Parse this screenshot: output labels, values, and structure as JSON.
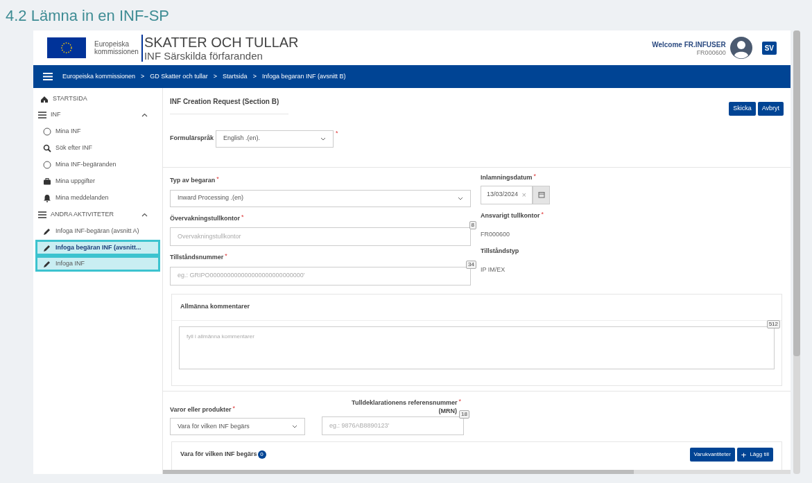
{
  "page_title": "4.2 Lämna in en INF-SP",
  "header": {
    "logo_line1": "Europeiska",
    "logo_line2": "kommissionen",
    "title": "SKATTER OCH TULLAR",
    "subtitle": "INF Särskilda förfaranden",
    "welcome": "Welcome FR.INFUSER",
    "user_id": "FR000600",
    "language": "SV"
  },
  "breadcrumbs": [
    "Europeiska kommissionen",
    "GD Skatter och tullar",
    "Startsida",
    "Infoga begaran INF (avsnitt B)"
  ],
  "breadcrumb_separator": ">",
  "sidebar": {
    "items": [
      {
        "kind": "link",
        "label": "STARTSIDA",
        "selected": false,
        "highlighted": false
      },
      {
        "kind": "group",
        "label": "INF",
        "expanded": true,
        "children": [
          {
            "kind": "circle",
            "label": "Mina INF",
            "selected": false,
            "highlighted": false
          },
          {
            "kind": "search",
            "label": "Sök efter INF",
            "selected": false,
            "highlighted": false
          },
          {
            "kind": "circle",
            "label": "Mina INF-begäranden",
            "selected": false,
            "highlighted": false
          },
          {
            "kind": "briefcase",
            "label": "Mina uppgifter",
            "selected": false,
            "highlighted": false
          },
          {
            "kind": "bell",
            "label": "Mina meddelanden",
            "selected": false,
            "highlighted": false
          }
        ]
      },
      {
        "kind": "group",
        "label": "ANDRA AKTIVITETER",
        "expanded": true,
        "children": [
          {
            "kind": "pencil",
            "label": "Infoga INF-begäran (avsnitt A)",
            "selected": false,
            "highlighted": false
          },
          {
            "kind": "pencil",
            "label": "Infoga begäran INF (avsnitt...",
            "selected": true,
            "highlighted": true
          },
          {
            "kind": "pencil",
            "label": "Infoga INF",
            "selected": false,
            "highlighted": true
          }
        ]
      }
    ]
  },
  "required_mark": "*",
  "main": {
    "heading": "INF Creation Request (Section B)",
    "buttons": [
      "Skicka",
      "Avbryt"
    ],
    "form_language": {
      "label": "Formulärspråk",
      "value": "English .(en).",
      "required": true
    },
    "left_fields": [
      {
        "kind": "select",
        "label": "Typ av begaran",
        "required": true,
        "value": "Inward Processing .(en)"
      },
      {
        "kind": "input",
        "label": "Övervakningstullkontor",
        "required": true,
        "placeholder": "Overvakningstullkontor",
        "counter": "8"
      },
      {
        "kind": "input",
        "label": "Tillståndsnummer",
        "required": true,
        "placeholder": "eg.: GRIPO000000000000000000000000000'",
        "counter": "34"
      }
    ],
    "date_field": {
      "label": "Inlamningsdatum",
      "required": true,
      "value": "13/03/2024",
      "clear": "×"
    },
    "right_fields": [
      {
        "label": "Ansvarigt tullkontor",
        "required": true,
        "value": "FR000600"
      },
      {
        "label": "Tillståndstyp",
        "required": false,
        "value": "IP IM/EX"
      }
    ],
    "comments": {
      "title": "Allmänna kommentarer",
      "placeholder": "fyll i allmänna kommentarer",
      "counter": "512"
    },
    "goods": {
      "label": "Varor eller produkter",
      "required": true,
      "value": "Vara för vilken INF begärs"
    },
    "mrn": {
      "label": "Tulldeklarationens referensnummer",
      "label2": "(MRN)",
      "required": true,
      "placeholder": "eg.: 9876AB8890123'",
      "counter": "18"
    },
    "items_card": {
      "title": "Vara för vilken INF begärs",
      "count": "0",
      "buttons": [
        {
          "kind": "plain",
          "label": "Varukvantiteter"
        },
        {
          "kind": "add",
          "label": "Lägg till",
          "icon": "+"
        }
      ]
    }
  }
}
